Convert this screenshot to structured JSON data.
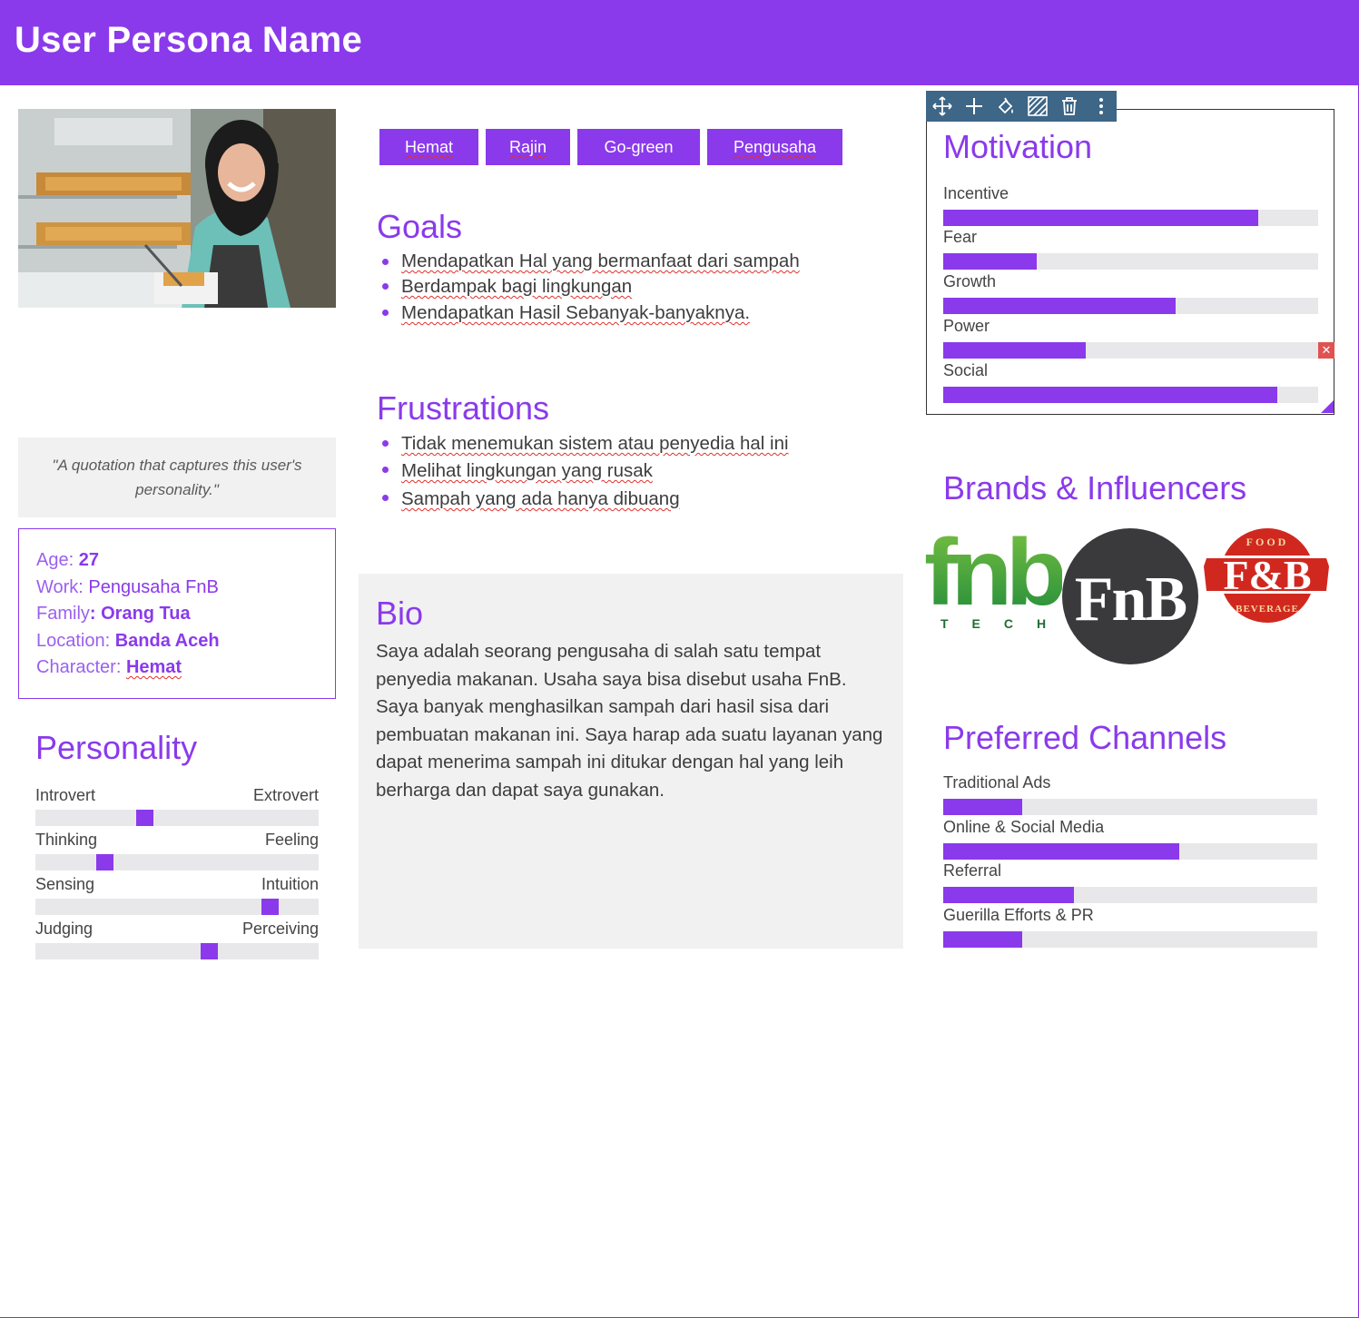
{
  "header": {
    "title": "User Persona Name"
  },
  "profile": {
    "photo_alt": "persona-photo",
    "quote": "\"A quotation that captures this user's personality.\"",
    "details": [
      {
        "label": "Age: ",
        "value": "27"
      },
      {
        "label": "Work: ",
        "value": "Pengusaha FnB"
      },
      {
        "label": "Family",
        "value": ": Orang Tua"
      },
      {
        "label": "Location: ",
        "value": "Banda Aceh"
      },
      {
        "label": "Character: ",
        "value": "Hemat"
      }
    ]
  },
  "personality": {
    "title": "Personality",
    "traits": [
      {
        "left": "Introvert",
        "right": "Extrovert",
        "value": 0.38
      },
      {
        "left": "Thinking",
        "right": "Feeling",
        "value": 0.23
      },
      {
        "left": "Sensing",
        "right": "Intuition",
        "value": 0.85
      },
      {
        "left": "Judging",
        "right": "Perceiving",
        "value": 0.62
      }
    ]
  },
  "tags": [
    "Hemat",
    "Rajin",
    "Go-green",
    "Pengusaha"
  ],
  "goals": {
    "title": "Goals",
    "items": [
      "Mendapatkan Hal yang bermanfaat dari sampah",
      "Berdampak bagi lingkungan",
      "Mendapatkan Hasil Sebanyak-banyaknya."
    ]
  },
  "frustrations": {
    "title": "Frustrations",
    "items": [
      "Tidak menemukan sistem atau penyedia hal ini",
      "Melihat lingkungan yang rusak",
      "Sampah yang ada hanya dibuang"
    ]
  },
  "bio": {
    "title": "Bio",
    "text": "Saya adalah seorang pengusaha di salah satu tempat penyedia makanan. Usaha saya bisa disebut usaha FnB. Saya banyak menghasilkan sampah dari hasil sisa dari pembuatan makanan ini. Saya harap ada suatu layanan yang dapat menerima sampah ini ditukar dengan hal yang leih berharga dan dapat saya gunakan."
  },
  "motivation": {
    "title": "Motivation",
    "items": [
      {
        "label": "Incentive",
        "value": 0.84
      },
      {
        "label": "Fear",
        "value": 0.25
      },
      {
        "label": "Growth",
        "value": 0.62
      },
      {
        "label": "Power",
        "value": 0.38
      },
      {
        "label": "Social",
        "value": 0.89
      }
    ]
  },
  "toolbar": {
    "icons": [
      "move-icon",
      "add-icon",
      "fill-icon",
      "pattern-icon",
      "trash-icon",
      "more-icon"
    ]
  },
  "brands": {
    "title": "Brands & Influencers",
    "logos": [
      {
        "name": "fnb-tech-logo",
        "text": "fnb",
        "sub": "TECH"
      },
      {
        "name": "fnb-circle-logo",
        "text": "FnB"
      },
      {
        "name": "fnb-food-beverage-logo",
        "text": "F&B",
        "top": "FOOD",
        "bottom": "BEVERAGE"
      }
    ]
  },
  "channels": {
    "title": "Preferred Channels",
    "items": [
      {
        "label": "Traditional Ads",
        "value": 0.21
      },
      {
        "label": "Online & Social Media",
        "value": 0.63
      },
      {
        "label": "Referral",
        "value": 0.35
      },
      {
        "label": "Guerilla Efforts & PR",
        "value": 0.21
      }
    ]
  },
  "colors": {
    "accent": "#8a3aeb",
    "toolbar": "#3d6687",
    "track": "#e8e8ea",
    "panel": "#f1f1f2"
  }
}
